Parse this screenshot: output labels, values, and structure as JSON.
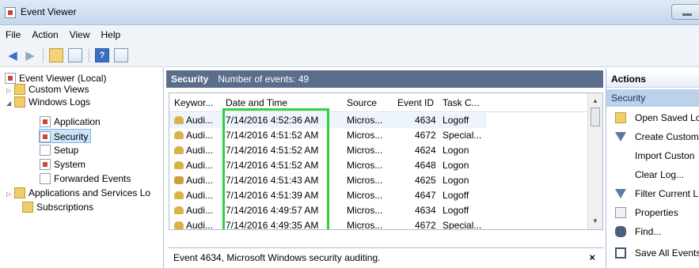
{
  "window": {
    "title": "Event Viewer"
  },
  "menu": [
    "File",
    "Action",
    "View",
    "Help"
  ],
  "toolbar": {
    "icons": [
      "back-arrow-icon",
      "forward-arrow-icon",
      "up-folder-icon",
      "show-pane-icon",
      "help-icon",
      "show-action-pane-icon"
    ]
  },
  "tree": {
    "root": "Event Viewer (Local)",
    "custom_views": "Custom Views",
    "windows_logs": "Windows Logs",
    "application": "Application",
    "security": "Security",
    "setup": "Setup",
    "system": "System",
    "forwarded": "Forwarded Events",
    "app_services": "Applications and Services Lo",
    "subscriptions": "Subscriptions"
  },
  "center": {
    "log_name": "Security",
    "count_label": "Number of events: 49",
    "columns": [
      "Keywor...",
      "Date and Time",
      "Source",
      "Event ID",
      "Task C..."
    ],
    "rows": [
      {
        "keyword": "Audi...",
        "datetime": "7/14/2016 4:52:36 AM",
        "source": "Micros...",
        "event_id": "4634",
        "task": "Logoff"
      },
      {
        "keyword": "Audi...",
        "datetime": "7/14/2016 4:51:52 AM",
        "source": "Micros...",
        "event_id": "4672",
        "task": "Special..."
      },
      {
        "keyword": "Audi...",
        "datetime": "7/14/2016 4:51:52 AM",
        "source": "Micros...",
        "event_id": "4624",
        "task": "Logon"
      },
      {
        "keyword": "Audi...",
        "datetime": "7/14/2016 4:51:52 AM",
        "source": "Micros...",
        "event_id": "4648",
        "task": "Logon"
      },
      {
        "keyword": "Audi...",
        "datetime": "7/14/2016 4:51:43 AM",
        "source": "Micros...",
        "event_id": "4625",
        "task": "Logon"
      },
      {
        "keyword": "Audi...",
        "datetime": "7/14/2016 4:51:39 AM",
        "source": "Micros...",
        "event_id": "4647",
        "task": "Logoff"
      },
      {
        "keyword": "Audi...",
        "datetime": "7/14/2016 4:49:57 AM",
        "source": "Micros...",
        "event_id": "4634",
        "task": "Logoff"
      },
      {
        "keyword": "Audi...",
        "datetime": "7/14/2016 4:49:35 AM",
        "source": "Micros...",
        "event_id": "4672",
        "task": "Special..."
      }
    ],
    "detail": "Event 4634, Microsoft Windows security auditing.",
    "close": "×"
  },
  "actions": {
    "header": "Actions",
    "section": "Security",
    "items": [
      "Open Saved Lo",
      "Create Custom",
      "Import Custon",
      "Clear Log...",
      "Filter Current L",
      "Properties",
      "Find...",
      "Save All Events"
    ]
  }
}
